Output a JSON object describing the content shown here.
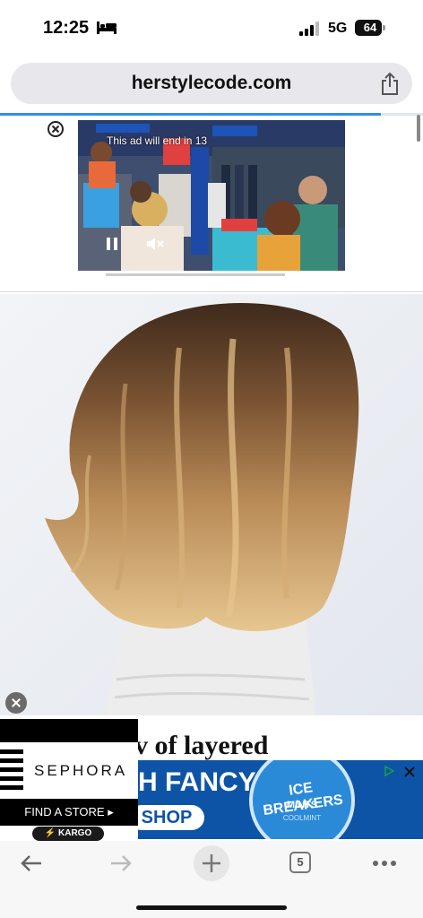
{
  "status": {
    "time": "12:25",
    "network": "5G",
    "battery": "64",
    "icons": [
      "bed-icon",
      "signal-icon",
      "battery-icon"
    ]
  },
  "browser": {
    "url": "herstylecode.com",
    "page_load_progress": 0.9,
    "toolbar": {
      "tab_count": "5",
      "icons": [
        "back-arrow-icon",
        "forward-arrow-icon",
        "plus-icon",
        "tabs-icon",
        "more-icon"
      ]
    }
  },
  "video_ad": {
    "timer_text": "This ad will end in 13",
    "icons": [
      "close-icon",
      "pause-icon",
      "mute-icon"
    ]
  },
  "article": {
    "heading_partial": "v of layered"
  },
  "banner_ad": {
    "sephora_logo": "SEPHORA",
    "find_store": "FIND A STORE",
    "kargo": "⚡ KARGO",
    "headline": "H FANCY",
    "cta": "SHOP NOW",
    "tin_brand": "ICE BREAKERS",
    "tin_sub": "MINTS",
    "tin_flavor": "COOLMINT",
    "accent": "#0e54a6"
  }
}
